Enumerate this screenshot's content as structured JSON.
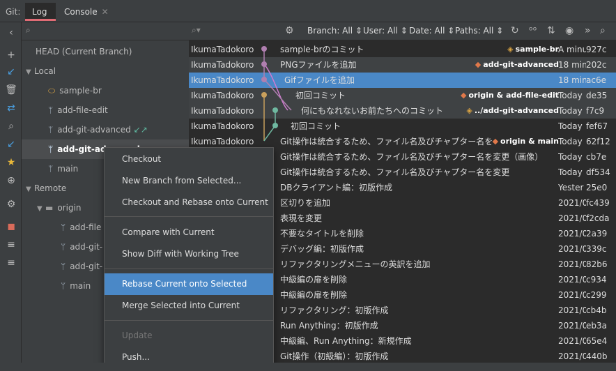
{
  "header": {
    "tool_label": "Git:",
    "tabs": [
      {
        "label": "Log"
      },
      {
        "label": "Console"
      }
    ],
    "close_glyph": "✕"
  },
  "left_toolbar": {
    "icons": [
      "chevron-left-icon",
      "add-icon",
      "update-icon",
      "delete-icon",
      "collapse-icon",
      "search-icon",
      "arrow-icon",
      "star-icon",
      "target-icon",
      "settings-icon",
      "folder-icon",
      "expand-all-icon",
      "collapse-all-icon"
    ]
  },
  "branches": {
    "head": "HEAD (Current Branch)",
    "local_label": "Local",
    "local": [
      "sample-br",
      "add-file-edit",
      "add-git-advanced",
      "add-git-advanced",
      "main"
    ],
    "remote_label": "Remote",
    "origin_label": "origin",
    "remote": [
      "add-file",
      "add-git-",
      "add-git-",
      "main"
    ]
  },
  "log_toolbar": {
    "search_placeholder": "",
    "filters": {
      "branch": "Branch: All",
      "user": "User: All",
      "date": "Date: All",
      "paths": "Paths: All"
    }
  },
  "commits": [
    {
      "author": "IkumaTadokoro",
      "message": "sample-brのコミット",
      "ref": "sample-br",
      "ref_type": "tag",
      "date": "A minu",
      "hash": "927c"
    },
    {
      "author": "IkumaTadokoro",
      "message": "PNGファイルを追加",
      "ref": "add-git-advanced",
      "ref_type": "branch",
      "date": "18 min",
      "hash": "202c"
    },
    {
      "author": "IkumaTadokoro",
      "message": "Gifファイルを追加",
      "ref": "",
      "date": "18 min",
      "hash": "ac6e"
    },
    {
      "author": "IkumaTadokoro",
      "message": "初回コミット",
      "ref": "origin & add-file-edit",
      "ref_type": "branch",
      "date": "Today",
      "hash": "de35"
    },
    {
      "author": "IkumaTadokoro",
      "message": "何にもなれないお前たちへのコミット",
      "ref": "../add-git-advanced",
      "ref_type": "tag",
      "date": "Today",
      "hash": "f7c9"
    },
    {
      "author": "IkumaTadokoro",
      "message": "初回コミット",
      "ref": "",
      "date": "Today",
      "hash": "fef67"
    },
    {
      "author": "IkumaTadokoro",
      "message": "Git操作は統合するため、ファイル名及びチャプター名を",
      "ref": "origin & main",
      "ref_type": "branch",
      "date": "Today",
      "hash": "62f12"
    },
    {
      "author": "",
      "message": "Git操作は統合するため、ファイル名及びチャプター名を変更（画像）",
      "ref": "",
      "date": "Today",
      "hash": "cb7e"
    },
    {
      "author": "",
      "message": "Git操作は統合するため、ファイル名及びチャプター名を変更",
      "ref": "",
      "date": "Today",
      "hash": "df534"
    },
    {
      "author": "",
      "message": "DBクライアント編：初版作成",
      "ref": "",
      "date": "Yester",
      "hash": "25e0"
    },
    {
      "author": "",
      "message": "区切りを追加",
      "ref": "",
      "date": "2021/0",
      "hash": "fc439"
    },
    {
      "author": "",
      "message": "表現を変更",
      "ref": "",
      "date": "2021/0",
      "hash": "f2cda"
    },
    {
      "author": "",
      "message": "不要なタイトルを削除",
      "ref": "",
      "date": "2021/0",
      "hash": "2a39"
    },
    {
      "author": "",
      "message": "デバッグ編：初版作成",
      "ref": "",
      "date": "2021/0",
      "hash": "339c"
    },
    {
      "author": "",
      "message": "リファクタリングメニューの英訳を追加",
      "ref": "",
      "date": "2021/0",
      "hash": "82b6"
    },
    {
      "author": "",
      "message": "中級編の扉を削除",
      "ref": "",
      "date": "2021/0",
      "hash": "c934"
    },
    {
      "author": "",
      "message": "中級編の扉を削除",
      "ref": "",
      "date": "2021/0",
      "hash": "c299"
    },
    {
      "author": "",
      "message": "リファクタリング：初版作成",
      "ref": "",
      "date": "2021/0",
      "hash": "cb4b"
    },
    {
      "author": "",
      "message": "Run Anything：初版作成",
      "ref": "",
      "date": "2021/0",
      "hash": "eb3a"
    },
    {
      "author": "",
      "message": "中級編、Run Anything：新規作成",
      "ref": "",
      "date": "2021/0",
      "hash": "65e4"
    },
    {
      "author": "",
      "message": "Git操作（初級編）：初版作成",
      "ref": "",
      "date": "2021/0",
      "hash": "440b"
    }
  ],
  "context_menu": [
    {
      "label": "Checkout"
    },
    {
      "label": "New Branch from Selected..."
    },
    {
      "label": "Checkout and Rebase onto Current"
    },
    {
      "label": "Compare with Current"
    },
    {
      "label": "Show Diff with Working Tree"
    },
    {
      "label": "Rebase Current onto Selected"
    },
    {
      "label": "Merge Selected into Current"
    },
    {
      "label": "Update"
    },
    {
      "label": "Push..."
    }
  ],
  "colors": {
    "accent": "#4a88c7",
    "tab_underline": "#e06c75",
    "graph_purple": "#b07fb0",
    "graph_pink": "#d07ad0",
    "graph_gold": "#c9a05c",
    "graph_green": "#6fb8a0"
  }
}
